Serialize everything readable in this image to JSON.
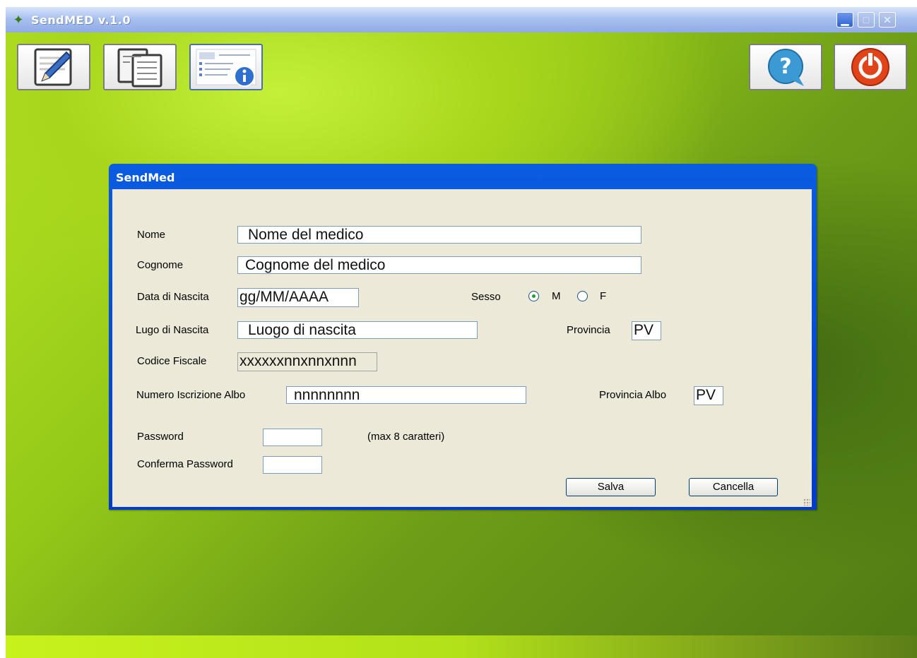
{
  "window": {
    "title": "SendMED v.1.0",
    "minimize_glyph": "▁",
    "maximize_glyph": "□",
    "close_glyph": "✕"
  },
  "toolbar": {
    "left_buttons": [
      {
        "icon": "edit-pen-icon"
      },
      {
        "icon": "copy-documents-icon"
      },
      {
        "icon": "document-info-icon"
      }
    ],
    "right_buttons": [
      {
        "icon": "help-icon"
      },
      {
        "icon": "power-exit-icon"
      }
    ]
  },
  "dialog": {
    "title": "SendMed",
    "nome_label": "Nome",
    "nome_value": "Nome del medico",
    "cognome_label": "Cognome",
    "cognome_value": "Cognome del medico",
    "data_nascita_label": "Data di Nascita",
    "data_nascita_value": "gg/MM/AAAA",
    "sesso_label": "Sesso",
    "sesso_options": [
      "M",
      "F"
    ],
    "sesso_selected": "M",
    "luogo_label": "Lugo di Nascita",
    "luogo_value": "Luogo di nascita",
    "provincia_label": "Provincia",
    "provincia_value": "PV",
    "codice_fiscale_label": "Codice Fiscale",
    "codice_fiscale_value": "xxxxxxnnxnnxnnn",
    "numero_albo_label": "Numero Iscrizione Albo",
    "numero_albo_value": "nnnnnnnn",
    "provincia_albo_label": "Provincia Albo",
    "provincia_albo_value": "PV",
    "password_label": "Password",
    "password_value": "",
    "password_hint": "(max 8 caratteri)",
    "conferma_password_label": "Conferma Password",
    "conferma_password_value": "",
    "salva_label": "Salva",
    "cancella_label": "Cancella"
  },
  "colors": {
    "titlebar": "#a9c1ef",
    "dialog_frame": "#0a5ce0",
    "dialog_body": "#ece9d8",
    "background_green": "#93c818"
  }
}
